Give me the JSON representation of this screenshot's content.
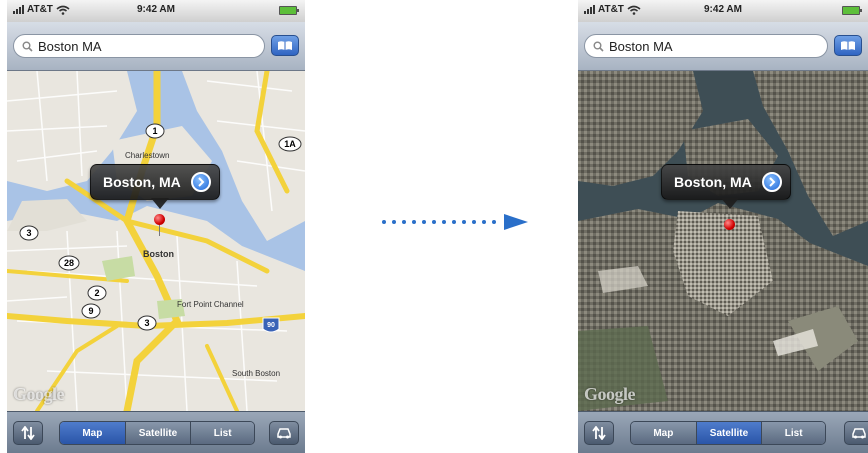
{
  "screens": [
    {
      "status": {
        "carrier": "AT&T",
        "time": "9:42 AM"
      },
      "search": {
        "value": "Boston MA"
      },
      "callout": {
        "title": "Boston, MA"
      },
      "map_labels": [
        "Charlestown",
        "Boston",
        "South Boston",
        "Fort Point Channel"
      ],
      "route_shields": [
        "1",
        "1A",
        "3",
        "28",
        "2",
        "9",
        "3",
        "90"
      ],
      "attribution": "Google",
      "segments": [
        {
          "label": "Map",
          "active": true
        },
        {
          "label": "Satellite",
          "active": false
        },
        {
          "label": "List",
          "active": false
        }
      ]
    },
    {
      "status": {
        "carrier": "AT&T",
        "time": "9:42 AM"
      },
      "search": {
        "value": "Boston MA"
      },
      "callout": {
        "title": "Boston, MA"
      },
      "attribution": "Google",
      "segments": [
        {
          "label": "Map",
          "active": false
        },
        {
          "label": "Satellite",
          "active": true
        },
        {
          "label": "List",
          "active": false
        }
      ]
    }
  ],
  "icons": {
    "left_toolbar": "updown-arrows-icon",
    "right_toolbar": "car-icon",
    "search": "magnifier-icon",
    "bookmark": "bookmark-book-icon",
    "transition": "dotted-arrow-icon"
  },
  "colors": {
    "water": "#a9c3e6",
    "highway": "#f3d23b",
    "pin": "#d10000",
    "segment_active": "#3563b8"
  }
}
